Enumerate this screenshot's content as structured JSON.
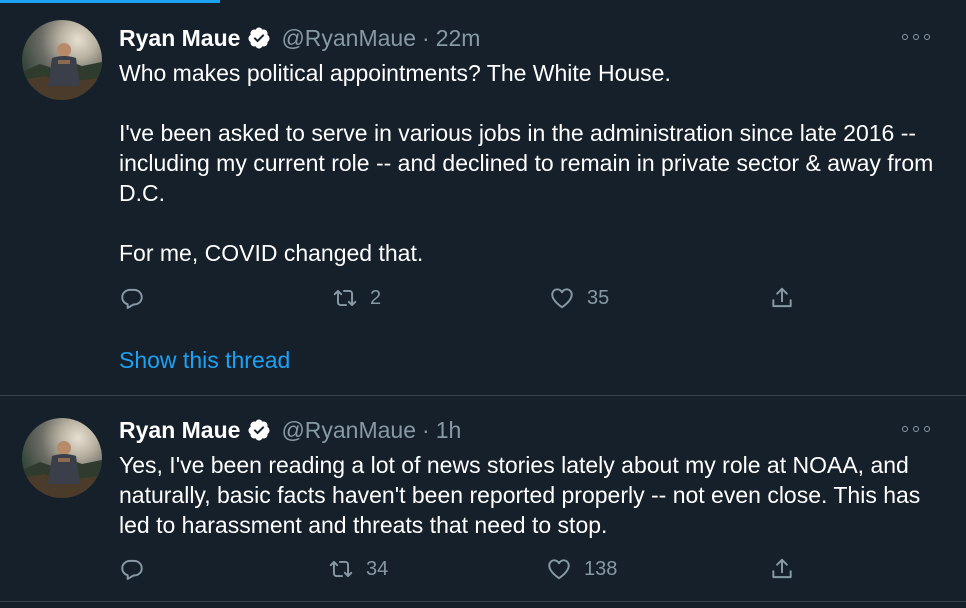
{
  "tweets": [
    {
      "author_name": "Ryan Maue",
      "handle": "@RyanMaue",
      "separator": "·",
      "time": "22m",
      "paragraphs": [
        "Who makes political appointments?  The White House.",
        "I've been asked to serve in various jobs in the administration since late 2016 -- including my current role -- and declined to remain in private sector & away from D.C.",
        "For me, COVID changed that."
      ],
      "reply_count": "",
      "retweet_count": "2",
      "like_count": "35",
      "show_thread": "Show this thread"
    },
    {
      "author_name": "Ryan Maue",
      "handle": "@RyanMaue",
      "separator": "·",
      "time": "1h",
      "paragraphs": [
        "Yes, I've been reading a lot of news stories lately about my role at NOAA, and naturally, basic facts haven't been reported properly -- not even close.  This has led to harassment and threats that need to stop."
      ],
      "reply_count": "",
      "retweet_count": "34",
      "like_count": "138"
    }
  ],
  "colors": {
    "background": "#15202b",
    "accent": "#1da1f2",
    "secondary_text": "#8899a6",
    "divider": "#38444d"
  },
  "icons": [
    "verified-badge-icon",
    "more-options-icon",
    "reply-icon",
    "retweet-icon",
    "like-icon",
    "share-icon"
  ]
}
